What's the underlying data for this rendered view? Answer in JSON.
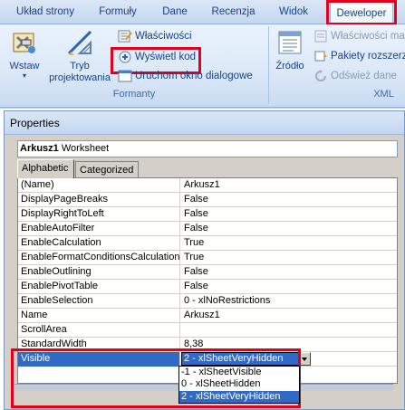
{
  "ribbon": {
    "tabs": [
      {
        "label": "Układ strony",
        "active": false
      },
      {
        "label": "Formuły",
        "active": false
      },
      {
        "label": "Dane",
        "active": false
      },
      {
        "label": "Recenzja",
        "active": false
      },
      {
        "label": "Widok",
        "active": false
      },
      {
        "label": "Deweloper",
        "active": true
      }
    ],
    "controls": {
      "insert_label": "Wstaw",
      "design_mode_label_1": "Tryb",
      "design_mode_label_2": "projektowania",
      "properties_label": "Właściwości",
      "view_code_label": "Wyświetl kod",
      "run_dialog_label": "Uruchom okno dialogowe",
      "group_title": "Formanty"
    },
    "xml": {
      "source_label": "Źródło",
      "map_properties_label": "Właściwości ma",
      "expansion_packs_label": "Pakiety rozszerz",
      "refresh_data_label": "Odśwież dane",
      "group_title": "XML"
    },
    "accent_color": "#e2001a"
  },
  "properties_window": {
    "title": "Properties",
    "object_name": "Arkusz1",
    "object_type": "Worksheet",
    "tabs": [
      "Alphabetic",
      "Categorized"
    ],
    "active_tab": "Alphabetic",
    "rows": [
      {
        "name": "(Name)",
        "value": "Arkusz1"
      },
      {
        "name": "DisplayPageBreaks",
        "value": "False"
      },
      {
        "name": "DisplayRightToLeft",
        "value": "False"
      },
      {
        "name": "EnableAutoFilter",
        "value": "False"
      },
      {
        "name": "EnableCalculation",
        "value": "True"
      },
      {
        "name": "EnableFormatConditionsCalculation",
        "value": "True"
      },
      {
        "name": "EnableOutlining",
        "value": "False"
      },
      {
        "name": "EnablePivotTable",
        "value": "False"
      },
      {
        "name": "EnableSelection",
        "value": "0 - xlNoRestrictions"
      },
      {
        "name": "Name",
        "value": "Arkusz1"
      },
      {
        "name": "ScrollArea",
        "value": ""
      },
      {
        "name": "StandardWidth",
        "value": "8,38"
      },
      {
        "name": "Visible",
        "value": "2 - xlSheetVeryHidden"
      }
    ],
    "dropdown_options": [
      "-1 - xlSheetVisible",
      "0 - xlSheetHidden",
      "2 - xlSheetVeryHidden"
    ],
    "dropdown_selected": "2 - xlSheetVeryHidden"
  }
}
